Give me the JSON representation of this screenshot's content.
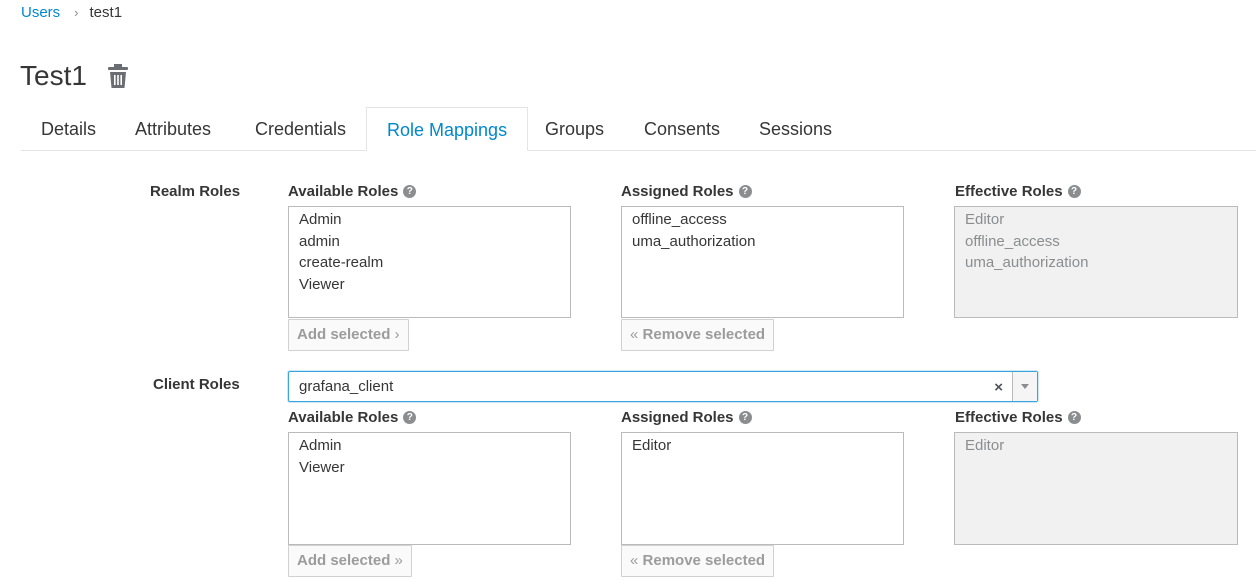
{
  "breadcrumb": {
    "parent": "Users",
    "separator": "›",
    "current": "test1"
  },
  "page_title": "Test1",
  "tabs": [
    {
      "label": "Details"
    },
    {
      "label": "Attributes"
    },
    {
      "label": "Credentials"
    },
    {
      "label": "Role Mappings",
      "active": true
    },
    {
      "label": "Groups"
    },
    {
      "label": "Consents"
    },
    {
      "label": "Sessions"
    }
  ],
  "realm": {
    "label": "Realm Roles",
    "available_label": "Available Roles",
    "assigned_label": "Assigned Roles",
    "effective_label": "Effective Roles",
    "available": [
      "Admin",
      "admin",
      "create-realm",
      "Viewer"
    ],
    "assigned": [
      "offline_access",
      "uma_authorization"
    ],
    "effective": [
      "Editor",
      "offline_access",
      "uma_authorization"
    ],
    "add_button": "Add selected",
    "add_glyph": "›",
    "remove_button": "Remove selected",
    "remove_glyph": "«"
  },
  "client": {
    "label": "Client Roles",
    "select_value": "grafana_client",
    "clear_glyph": "×",
    "available_label": "Available Roles",
    "assigned_label": "Assigned Roles",
    "effective_label": "Effective Roles",
    "available": [
      "Admin",
      "Viewer"
    ],
    "assigned": [
      "Editor"
    ],
    "effective": [
      "Editor"
    ],
    "add_button": "Add selected",
    "add_glyph": "»",
    "remove_button": "Remove selected",
    "remove_glyph": "«"
  },
  "help_glyph": "?",
  "colors": {
    "link": "#0088ce",
    "text": "#363636",
    "focus": "#39a5dc",
    "muted": "#9c9c9c"
  }
}
